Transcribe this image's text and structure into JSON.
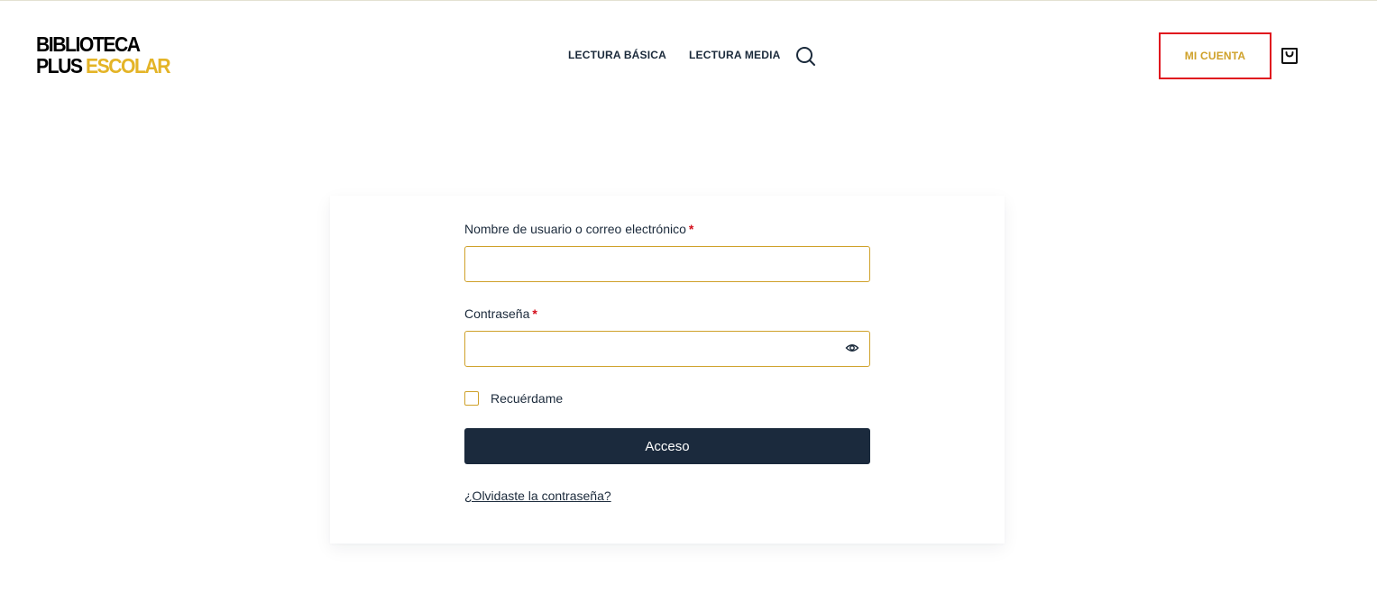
{
  "header": {
    "logo": {
      "line1": "BIBLIOTECA",
      "line2_dark": "PLUS",
      "line2_accent": "ESCOLAR"
    },
    "nav": [
      {
        "label": "LECTURA BÁSICA"
      },
      {
        "label": "LECTURA MEDIA"
      }
    ],
    "search_icon": "search-icon",
    "account_label": "MI CUENTA",
    "cart_icon": "shopping-bag-icon"
  },
  "login_form": {
    "username": {
      "label": "Nombre de usuario o correo electrónico",
      "required_marker": "*",
      "value": ""
    },
    "password": {
      "label": "Contraseña",
      "required_marker": "*",
      "value": "",
      "toggle_icon": "eye-icon"
    },
    "remember_label": "Recuérdame",
    "remember_checked": false,
    "submit_label": "Acceso",
    "forgot_label": "¿Olvidaste la contraseña?"
  },
  "colors": {
    "accent": "#cfa12a",
    "logo_accent": "#e4b427",
    "navy": "#1b2a3d",
    "required": "#d40f1c",
    "highlight_border": "#e0141e"
  }
}
